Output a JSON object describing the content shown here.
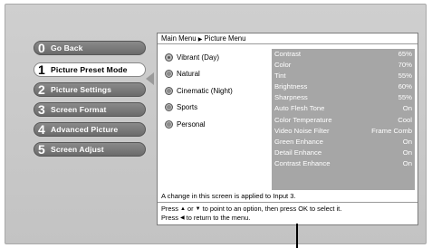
{
  "menu": {
    "items": [
      {
        "num": "0",
        "label": "Go Back"
      },
      {
        "num": "1",
        "label": "Picture Preset Mode",
        "active": true
      },
      {
        "num": "2",
        "label": "Picture Settings"
      },
      {
        "num": "3",
        "label": "Screen Format"
      },
      {
        "num": "4",
        "label": "Advanced Picture"
      },
      {
        "num": "5",
        "label": "Screen Adjust"
      }
    ]
  },
  "breadcrumb": {
    "root": "Main Menu",
    "sep": "▶",
    "current": "Picture Menu"
  },
  "presets": {
    "selected": "Vibrant (Day)",
    "items": [
      "Vibrant (Day)",
      "Natural",
      "Cinematic (Night)",
      "Sports",
      "Personal"
    ]
  },
  "settings": [
    {
      "label": "Contrast",
      "value": "65%"
    },
    {
      "label": "Color",
      "value": "70%"
    },
    {
      "label": "Tint",
      "value": "55%"
    },
    {
      "label": "Brightness",
      "value": "60%"
    },
    {
      "label": "Sharpness",
      "value": "55%"
    },
    {
      "label": "Auto Flesh Tone",
      "value": "On"
    },
    {
      "label": "Color Temperature",
      "value": "Cool"
    },
    {
      "label": "Video Noise Filter",
      "value": "Frame Comb"
    },
    {
      "label": "Green Enhance",
      "value": "On"
    },
    {
      "label": "Detail Enhance",
      "value": "On"
    },
    {
      "label": "Contrast Enhance",
      "value": "On"
    }
  ],
  "note": "A change in this screen is applied to Input 3.",
  "help": {
    "line1_a": "Press",
    "up_glyph": "▲",
    "or": "or",
    "down_glyph": "▼",
    "line1_b": "to point to an option, then press OK to select it.",
    "line2_a": "Press",
    "left_glyph": "◀",
    "line2_b": "to return to the menu."
  }
}
